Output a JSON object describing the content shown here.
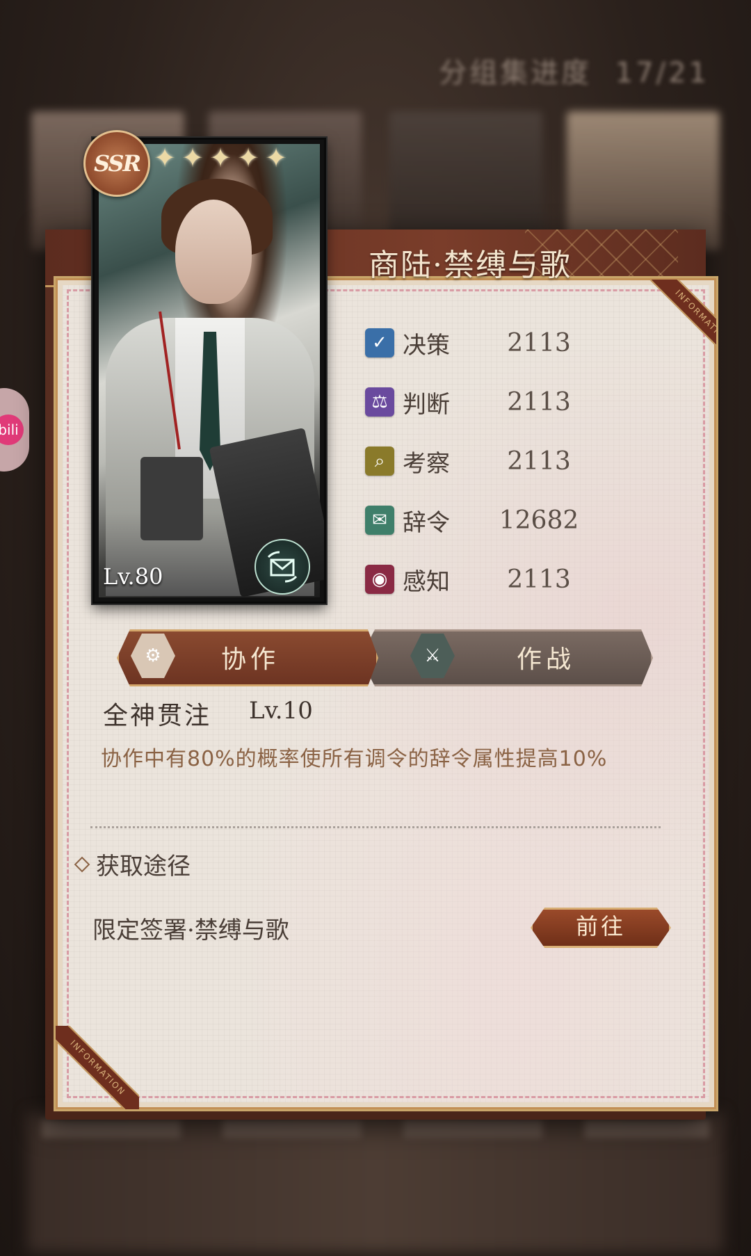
{
  "background": {
    "progress_label": "分组集进度",
    "progress_value": "17/21"
  },
  "card": {
    "rarity": "SSR",
    "stars": 5,
    "level": "Lv.80",
    "attribute_icon": "letter-icon"
  },
  "title": "商陆·禁缚与歌",
  "ribbon_text": "INFORMATION",
  "stats": [
    {
      "icon": "decision-icon",
      "name": "决策",
      "value": "2113",
      "color": "#3a6fa8"
    },
    {
      "icon": "judgment-icon",
      "name": "判断",
      "value": "2113",
      "color": "#6a4a9e"
    },
    {
      "icon": "observation-icon",
      "name": "考察",
      "value": "2113",
      "color": "#8a7a2a"
    },
    {
      "icon": "rhetoric-icon",
      "name": "辞令",
      "value": "12682",
      "color": "#3f7f6a"
    },
    {
      "icon": "perception-icon",
      "name": "感知",
      "value": "2113",
      "color": "#8a2a44"
    }
  ],
  "tabs": {
    "cooperation": "协作",
    "battle": "作战",
    "active": "cooperation"
  },
  "skill": {
    "name": "全神贯注",
    "level": "Lv.10",
    "description": "协作中有80%的概率使所有调令的辞令属性提高10%"
  },
  "acquire": {
    "section_title": "获取途径",
    "source": "限定签署·禁缚与歌",
    "button": "前往"
  },
  "side_logo": "bili"
}
